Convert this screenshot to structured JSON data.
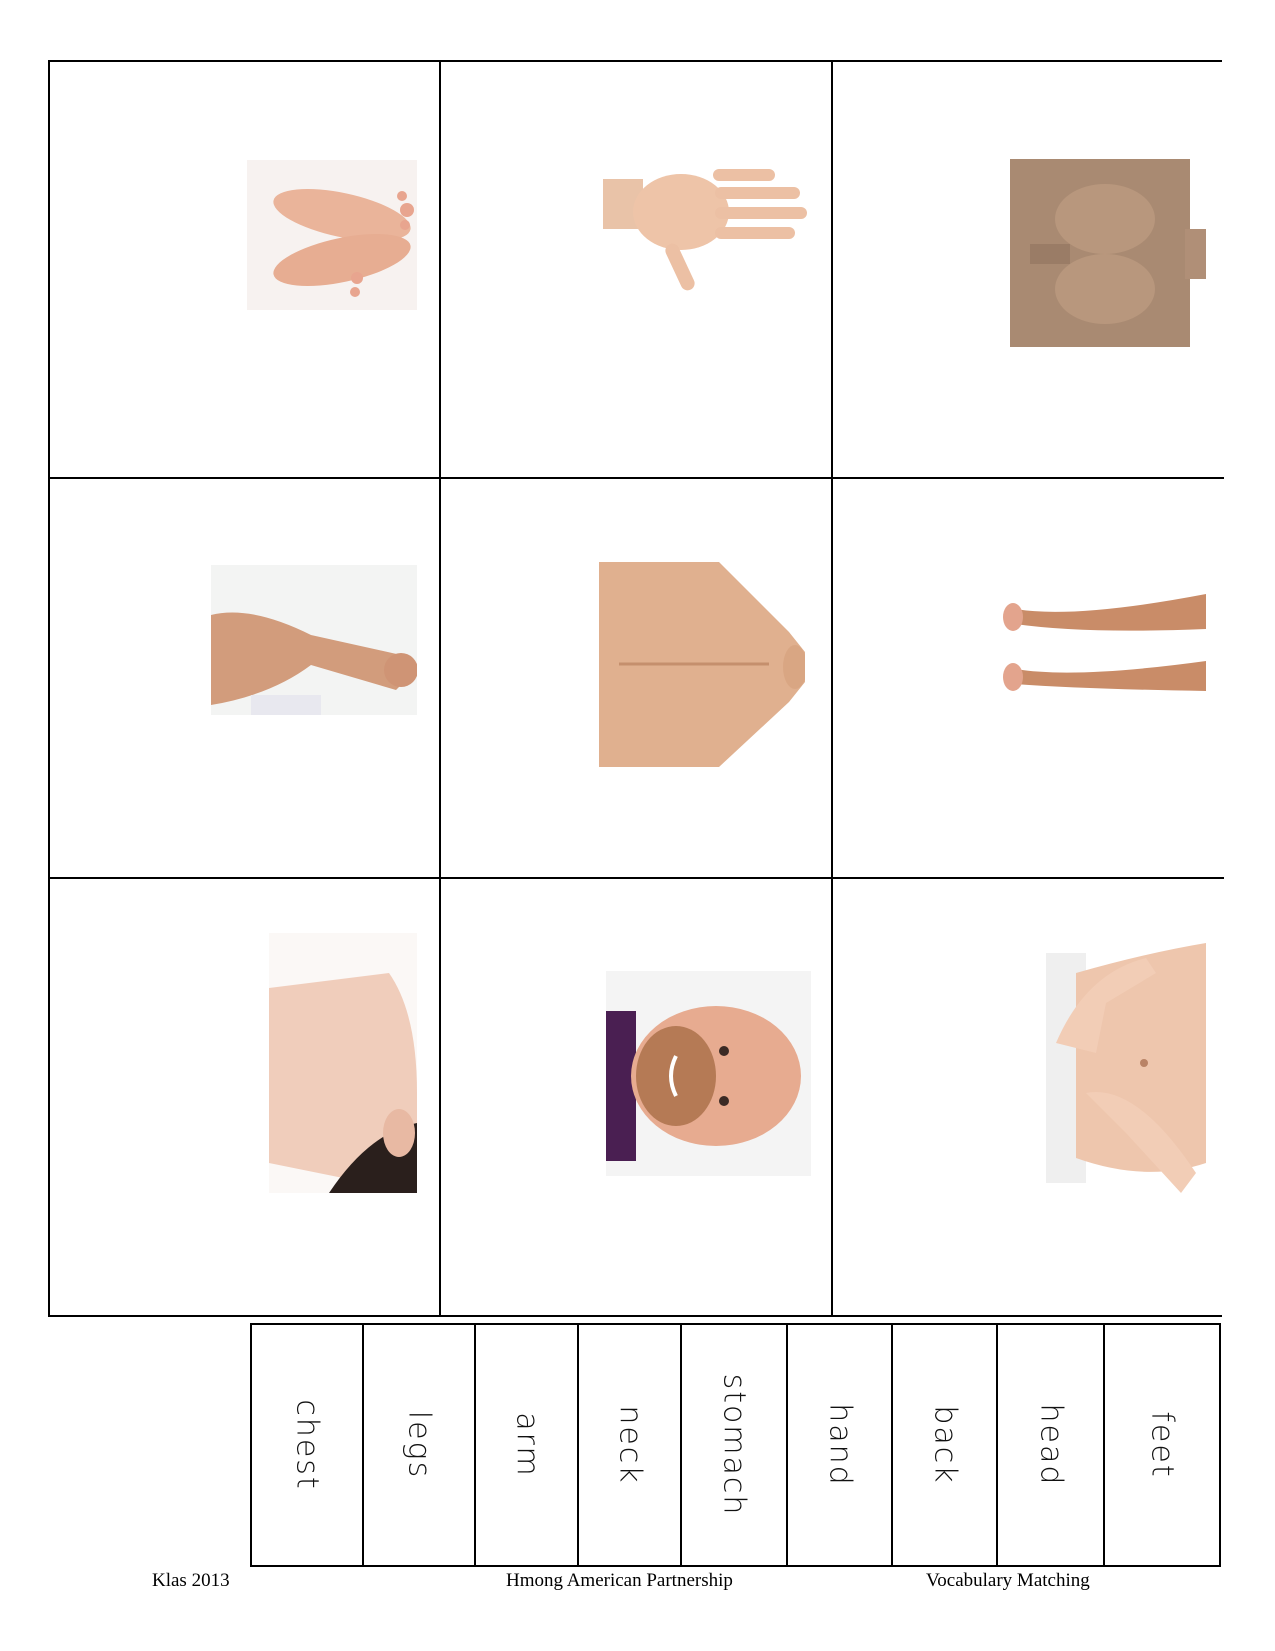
{
  "pictures": [
    {
      "icon": "feet-photo-icon"
    },
    {
      "icon": "hand-photo-icon"
    },
    {
      "icon": "chest-photo-icon"
    },
    {
      "icon": "arm-photo-icon"
    },
    {
      "icon": "back-photo-icon"
    },
    {
      "icon": "legs-photo-icon"
    },
    {
      "icon": "neck-photo-icon"
    },
    {
      "icon": "head-photo-icon"
    },
    {
      "icon": "stomach-photo-icon"
    }
  ],
  "words": [
    "chest",
    "legs",
    "arm",
    "neck",
    "stomach",
    "hand",
    "back",
    "head",
    "feet"
  ],
  "footer": {
    "left": "Klas 2013",
    "center": "Hmong American Partnership",
    "right": "Vocabulary Matching"
  },
  "colors": {
    "skin": "#e8b99a",
    "skin_shadow": "#c9957a",
    "border": "#000000"
  }
}
